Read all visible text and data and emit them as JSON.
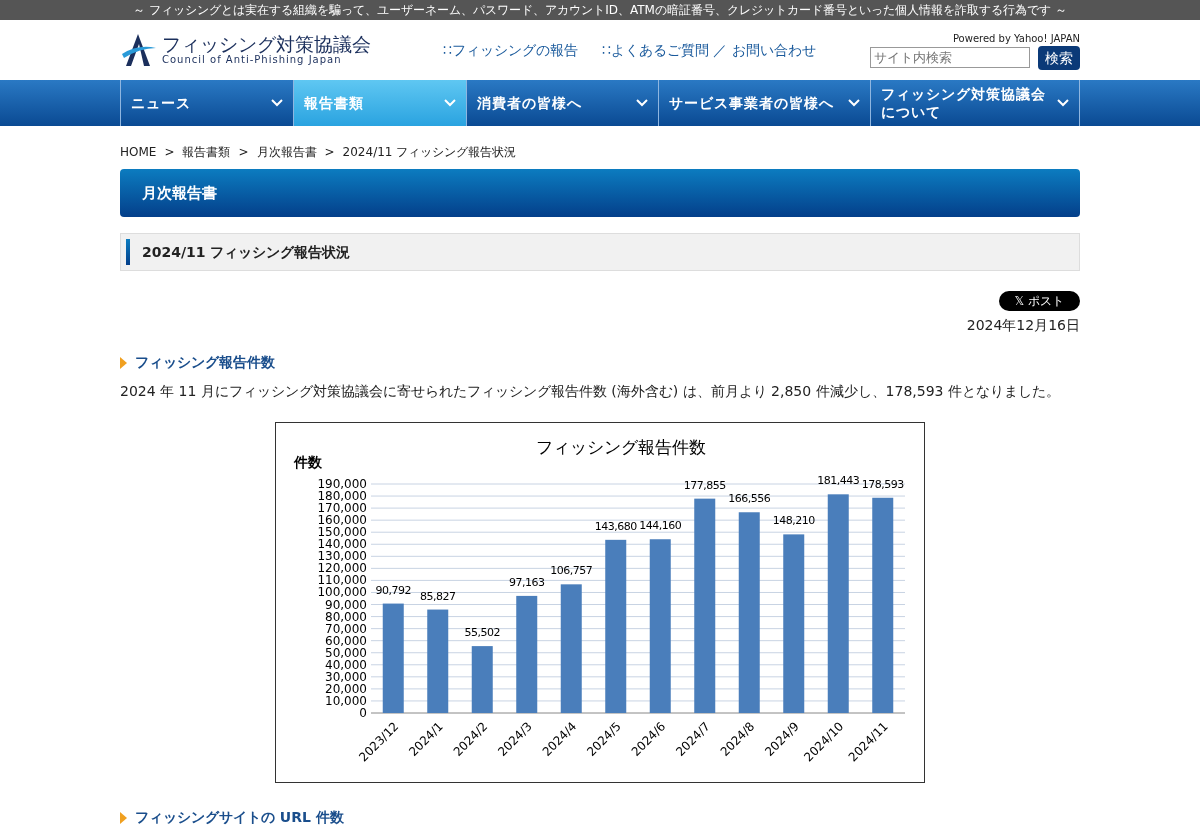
{
  "top_banner": "～ フィッシングとは実在する組織を騙って、ユーザーネーム、パスワード、アカウントID、ATMの暗証番号、クレジットカード番号といった個人情報を詐取する行為です ～",
  "header": {
    "logo_title": "フィッシング対策協議会",
    "logo_subtitle": "Council of Anti-Phishing Japan",
    "links": [
      {
        "marker": "∷",
        "label": "フィッシングの報告"
      },
      {
        "marker": "∷",
        "label": "よくあるご質問 ／ お問い合わせ"
      }
    ],
    "powered_by": "Powered by Yahoo! JAPAN",
    "search": {
      "placeholder": "サイト内検索",
      "button": "検索"
    }
  },
  "nav": [
    {
      "label": "ニュース",
      "selected": false
    },
    {
      "label": "報告書類",
      "selected": true
    },
    {
      "label": "消費者の皆様へ",
      "selected": false
    },
    {
      "label": "サービス事業者の皆様へ",
      "selected": false
    },
    {
      "label": "フィッシング対策協議会について",
      "selected": false
    }
  ],
  "breadcrumb": [
    "HOME",
    "報告書類",
    "月次報告書",
    "2024/11 フィッシング報告状況"
  ],
  "breadcrumb_separator": ">",
  "page_title": "月次報告書",
  "article_title": "2024/11 フィッシング報告状況",
  "share_button": {
    "icon": "𝕏",
    "label": "ポスト"
  },
  "date": "2024年12月16日",
  "sections": [
    {
      "heading": "フィッシング報告件数",
      "paragraph": "2024 年 11 月にフィッシング対策協議会に寄せられたフィッシング報告件数 (海外含む) は、前月より 2,850 件減少し、178,593 件となりました。",
      "chart_data": {
        "type": "bar",
        "title": "フィッシング報告件数",
        "ylabel": "件数",
        "categories": [
          "2023/12",
          "2024/1",
          "2024/2",
          "2024/3",
          "2024/4",
          "2024/5",
          "2024/6",
          "2024/7",
          "2024/8",
          "2024/9",
          "2024/10",
          "2024/11"
        ],
        "series": [
          {
            "color": "#4a7ebb",
            "values": [
              90792,
              85827,
              55502,
              97163,
              106757,
              143680,
              144160,
              177855,
              166556,
              148210,
              181443,
              178593
            ]
          }
        ],
        "value_labels": [
          "90,792",
          "85,827",
          "55,502",
          "97,163",
          "106,757",
          "143,680",
          "144,160",
          "177,855",
          "166,556",
          "148,210",
          "181,443",
          "178,593"
        ],
        "ylim": [
          0,
          190000
        ],
        "grid": true,
        "yticks": [
          {
            "value": 0,
            "label": "0"
          },
          {
            "value": 10000,
            "label": "10,000"
          },
          {
            "value": 20000,
            "label": "20,000"
          },
          {
            "value": 30000,
            "label": "30,000"
          },
          {
            "value": 40000,
            "label": "40,000"
          },
          {
            "value": 50000,
            "label": "50,000"
          },
          {
            "value": 60000,
            "label": "60,000"
          },
          {
            "value": 70000,
            "label": "70,000"
          },
          {
            "value": 80000,
            "label": "80,000"
          },
          {
            "value": 90000,
            "label": "90,000"
          },
          {
            "value": 100000,
            "label": "100,000"
          },
          {
            "value": 110000,
            "label": "110,000"
          },
          {
            "value": 120000,
            "label": "120,000"
          },
          {
            "value": 130000,
            "label": "130,000"
          },
          {
            "value": 140000,
            "label": "140,000"
          },
          {
            "value": 150000,
            "label": "150,000"
          },
          {
            "value": 160000,
            "label": "160,000"
          },
          {
            "value": 170000,
            "label": "170,000"
          },
          {
            "value": 180000,
            "label": "180,000"
          },
          {
            "value": 190000,
            "label": "190,000"
          }
        ]
      }
    },
    {
      "heading": "フィッシングサイトの URL 件数"
    }
  ]
}
